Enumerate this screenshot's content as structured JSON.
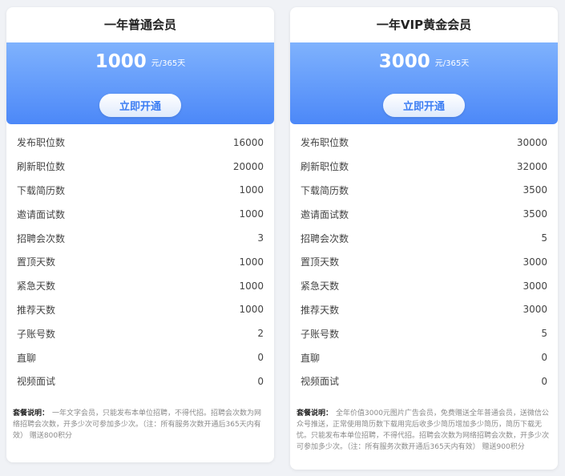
{
  "plans": [
    {
      "title": "一年普通会员",
      "price": "1000",
      "unit": "元/365天",
      "button_label": "立即开通",
      "features": [
        {
          "label": "发布职位数",
          "value": "16000"
        },
        {
          "label": "刷新职位数",
          "value": "20000"
        },
        {
          "label": "下载简历数",
          "value": "1000"
        },
        {
          "label": "邀请面试数",
          "value": "1000"
        },
        {
          "label": "招聘会次数",
          "value": "3"
        },
        {
          "label": "置顶天数",
          "value": "1000"
        },
        {
          "label": "紧急天数",
          "value": "1000"
        },
        {
          "label": "推荐天数",
          "value": "1000"
        },
        {
          "label": "子账号数",
          "value": "2"
        },
        {
          "label": "直聊",
          "value": "0"
        },
        {
          "label": "视频面试",
          "value": "0"
        }
      ],
      "note_label": "套餐说明：",
      "note_text": "一年文字会员，只能发布本单位招聘，不得代招。招聘会次数为网络招聘会次数，开多少次可参加多少次。（注：所有服务次数开通后365天内有效） 赠送800积分"
    },
    {
      "title": "一年VIP黄金会员",
      "price": "3000",
      "unit": "元/365天",
      "button_label": "立即开通",
      "features": [
        {
          "label": "发布职位数",
          "value": "30000"
        },
        {
          "label": "刷新职位数",
          "value": "32000"
        },
        {
          "label": "下载简历数",
          "value": "3500"
        },
        {
          "label": "邀请面试数",
          "value": "3500"
        },
        {
          "label": "招聘会次数",
          "value": "5"
        },
        {
          "label": "置顶天数",
          "value": "3000"
        },
        {
          "label": "紧急天数",
          "value": "3000"
        },
        {
          "label": "推荐天数",
          "value": "3000"
        },
        {
          "label": "子账号数",
          "value": "5"
        },
        {
          "label": "直聊",
          "value": "0"
        },
        {
          "label": "视频面试",
          "value": "0"
        }
      ],
      "note_label": "套餐说明：",
      "note_text": "全年价值3000元图片广告会员，免费赠送全年普通会员，送微信公众号推送，正常使用简历数下载用完后收多少简历增加多少简历，简历下载无忧。只能发布本单位招聘，不得代招。招聘会次数为网络招聘会次数，开多少次可参加多少次。（注：所有服务次数开通后365天内有效） 赠送900积分"
    }
  ],
  "colors": {
    "banner_top": "#7fb2fd",
    "banner_bottom": "#4c88f8",
    "button_text": "#3d7ef3"
  }
}
